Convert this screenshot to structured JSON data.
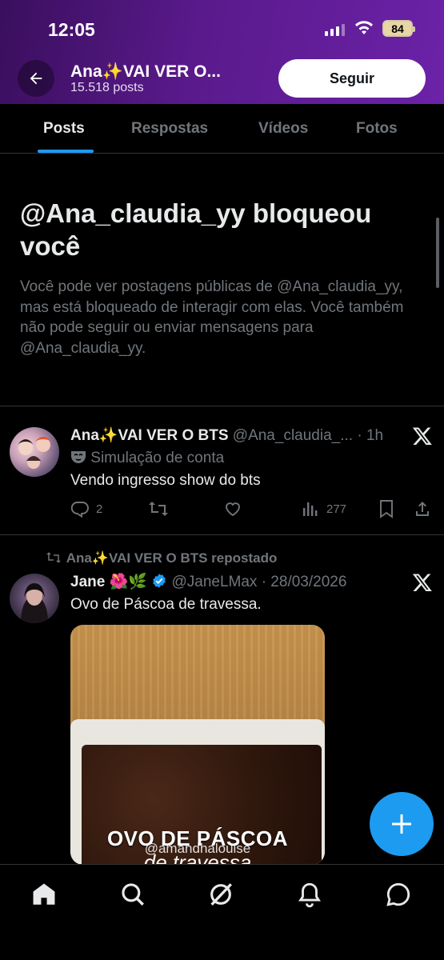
{
  "status_bar": {
    "time": "12:05",
    "battery": "84"
  },
  "header": {
    "title": "Ana✨VAI VER O...",
    "post_count": "15.518 posts",
    "follow_label": "Seguir"
  },
  "tabs": [
    {
      "label": "Posts",
      "active": true
    },
    {
      "label": "Respostas",
      "active": false
    },
    {
      "label": "Vídeos",
      "active": false
    },
    {
      "label": "Fotos",
      "active": false
    }
  ],
  "blocked": {
    "title": "@Ana_claudia_yy bloqueou você",
    "message": "Você pode ver postagens públicas de @Ana_claudia_yy, mas está bloqueado de interagir com elas. Você também não pode seguir ou enviar mensagens para @Ana_claudia_yy."
  },
  "posts": [
    {
      "name": "Ana✨VAI VER O BTS",
      "handle": "@Ana_claudia_...",
      "time": "· 1h",
      "label": "Simulação de conta",
      "text": "Vendo ingresso show do bts",
      "replies": "2",
      "reposts": "",
      "likes": "",
      "views": "277"
    },
    {
      "repost_note": "Ana✨VAI VER O BTS repostado",
      "name": "Jane 🌺🌿",
      "handle": "@JaneLMax",
      "time": "· 28/03/2026",
      "text": "Ovo de Páscoa de travessa.",
      "media_caption": "OVO DE PÁSCOA",
      "media_watermark": "@amandhalouise",
      "media_caption2": "de travessa"
    }
  ],
  "colors": {
    "accent": "#1d9bf0",
    "header_bg": "#5a1a8c",
    "muted": "#71767b"
  },
  "icons": [
    "back-arrow-icon",
    "x-logo-icon",
    "reply-icon",
    "repost-icon",
    "like-icon",
    "views-icon",
    "bookmark-icon",
    "share-icon",
    "verified-icon",
    "compose-plus-icon",
    "home-icon",
    "search-icon",
    "grok-icon",
    "notifications-icon",
    "messages-icon"
  ]
}
